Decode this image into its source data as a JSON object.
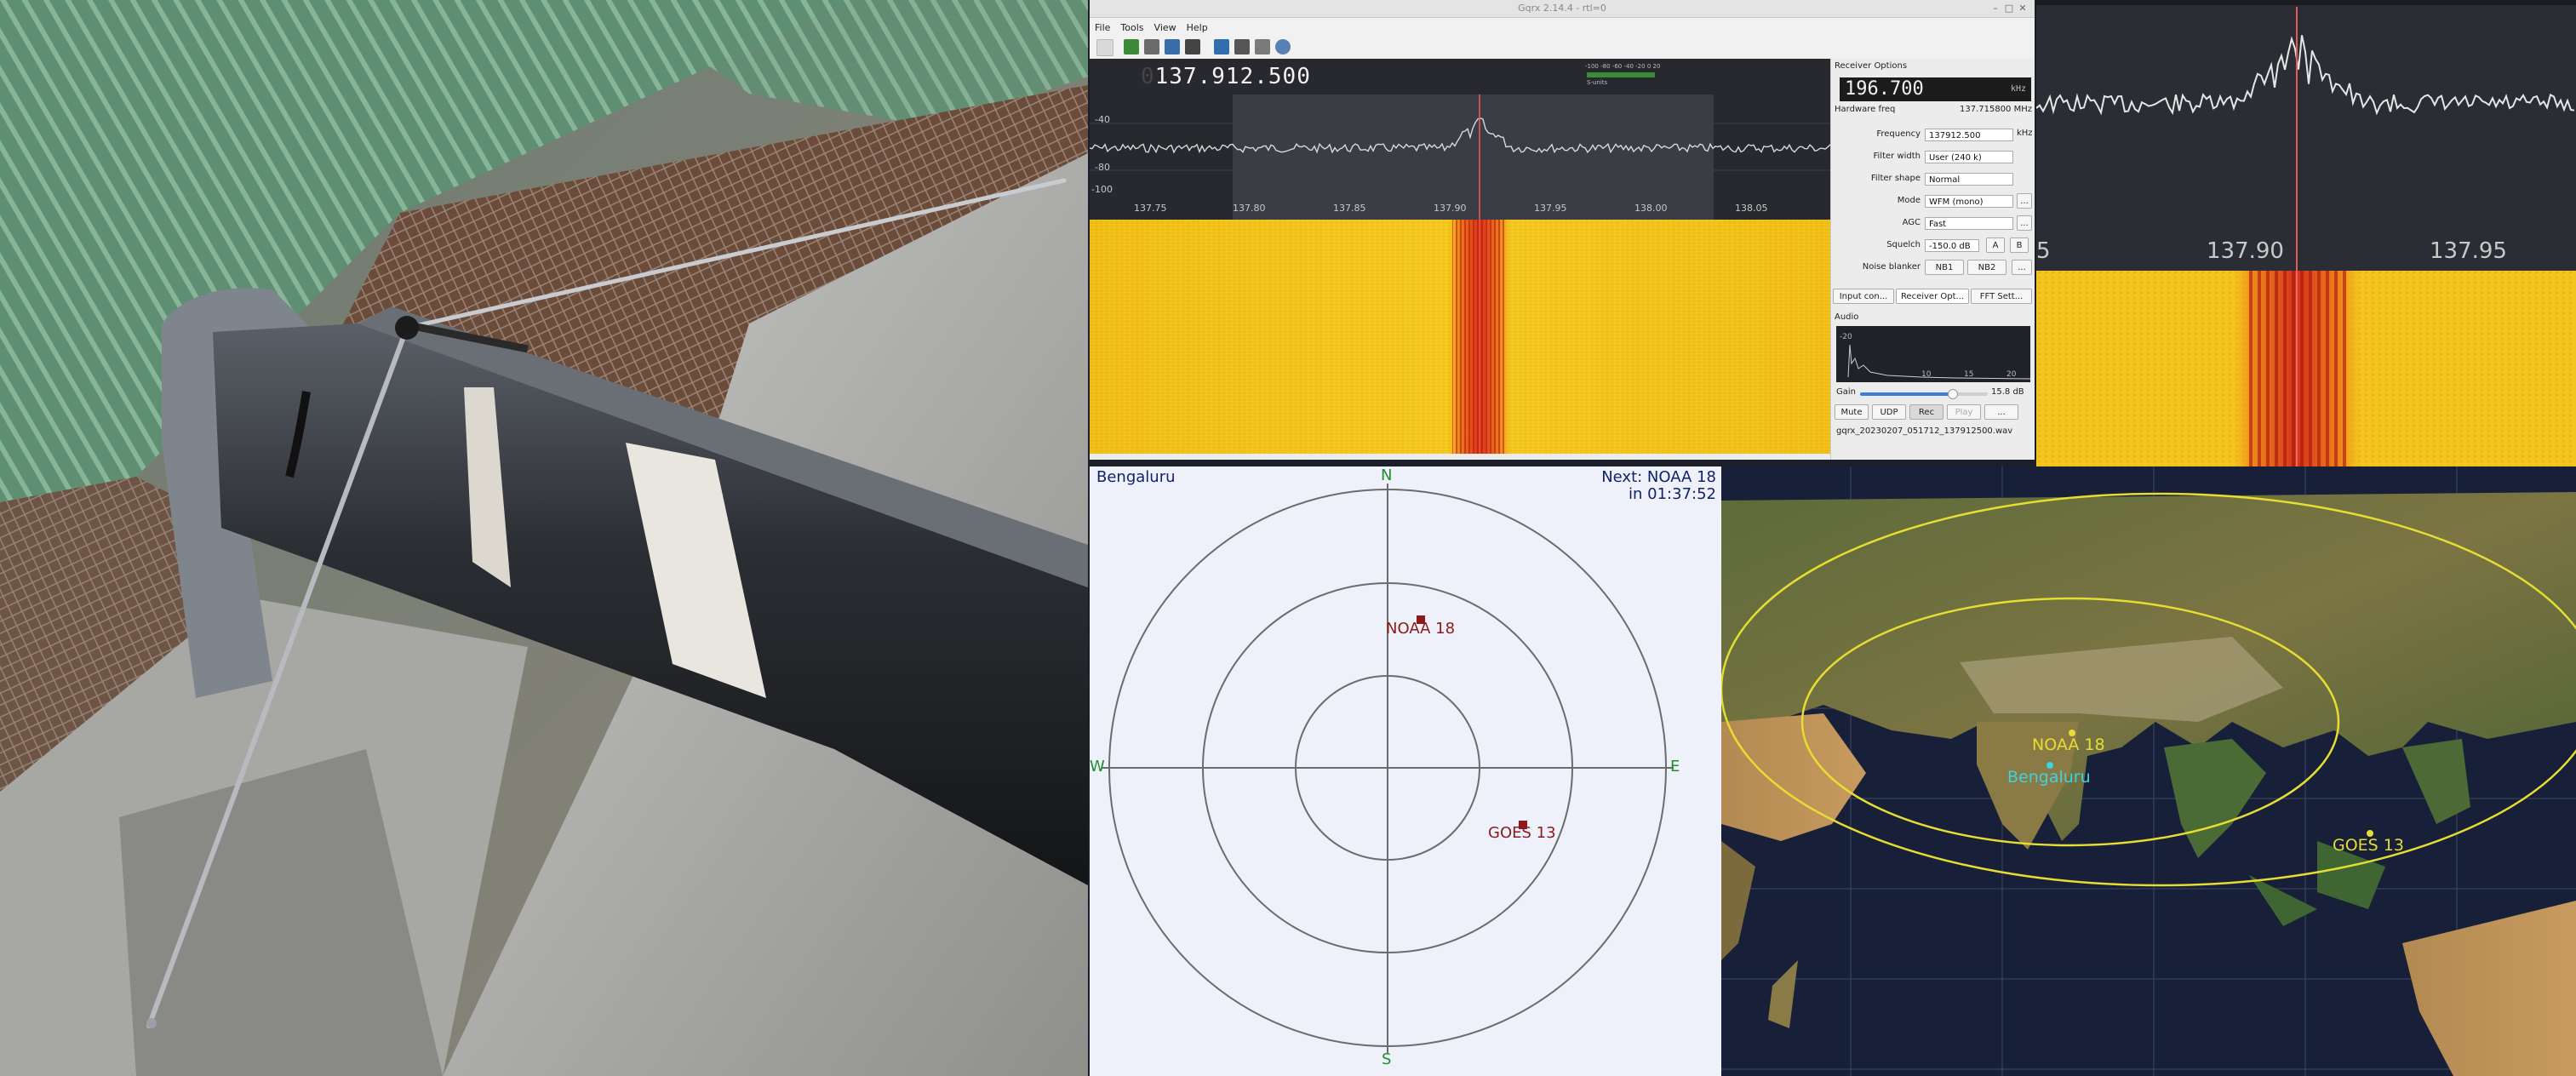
{
  "gqrx": {
    "title": "Gqrx 2.14.4 - rtl=0",
    "menu": [
      "File",
      "Tools",
      "View",
      "Help"
    ],
    "frequency_display_lead": "0",
    "frequency_display": "137.912.500",
    "signal_meter_ticks": [
      "-100",
      "-80",
      "-60",
      "-40",
      "-20",
      "0",
      "20"
    ],
    "signal_meter_unit": "S-units",
    "db_axis": [
      "-40",
      "-80",
      "-100"
    ],
    "freq_axis": [
      "137.75",
      "137.80",
      "137.85",
      "137.90",
      "137.95",
      "138.00",
      "138.05"
    ]
  },
  "receiver_options": {
    "dock_title": "Receiver Options",
    "lcd_value": "196.700",
    "lcd_unit": "kHz",
    "hardware_freq_label": "Hardware freq",
    "hardware_freq_value": "137.715800 MHz",
    "frequency_label": "Frequency",
    "frequency_value": "137912.500",
    "frequency_unit": "kHz",
    "filter_width_label": "Filter width",
    "filter_width_value": "User (240 k)",
    "filter_shape_label": "Filter shape",
    "filter_shape_value": "Normal",
    "mode_label": "Mode",
    "mode_value": "WFM (mono)",
    "agc_label": "AGC",
    "agc_value": "Fast",
    "squelch_label": "Squelch",
    "squelch_value": "-150.0 dB",
    "squelch_a": "A",
    "squelch_b": "B",
    "noise_blanker_label": "Noise blanker",
    "nb1": "NB1",
    "nb2": "NB2",
    "more": "...",
    "tabs": [
      "Input con...",
      "Receiver Opt...",
      "FFT Sett..."
    ]
  },
  "audio": {
    "title": "Audio",
    "axis_y": "-20",
    "axis_x": [
      "10",
      "15",
      "20"
    ],
    "gain_label": "Gain",
    "gain_value": "15.8 dB",
    "gain_level": 0.72,
    "buttons": [
      "Mute",
      "UDP",
      "Rec",
      "Play",
      "..."
    ],
    "file_name": "gqrx_20230207_051712_137912500.wav"
  },
  "zoom_panel": {
    "freq_labels": [
      "5",
      "137.90",
      "137.95"
    ]
  },
  "polar": {
    "location": "Bengaluru",
    "next_label": "Next: NOAA 18",
    "next_time": "in 01:37:52",
    "north": "N",
    "south": "S",
    "east": "E",
    "west": "W",
    "sat1": "NOAA 18",
    "sat2": "GOES 13"
  },
  "map": {
    "sat1": "NOAA 18",
    "ground": "Bengaluru",
    "sat2": "GOES 13"
  },
  "colors": {
    "waterfall_bg": "#f2c21a",
    "signal_red": "#e0451b",
    "polar_text": "#12226a",
    "sat_marker": "#8b1a1a",
    "map_yellow": "#e6dd33",
    "ground_cyan": "#3fd2e0"
  }
}
